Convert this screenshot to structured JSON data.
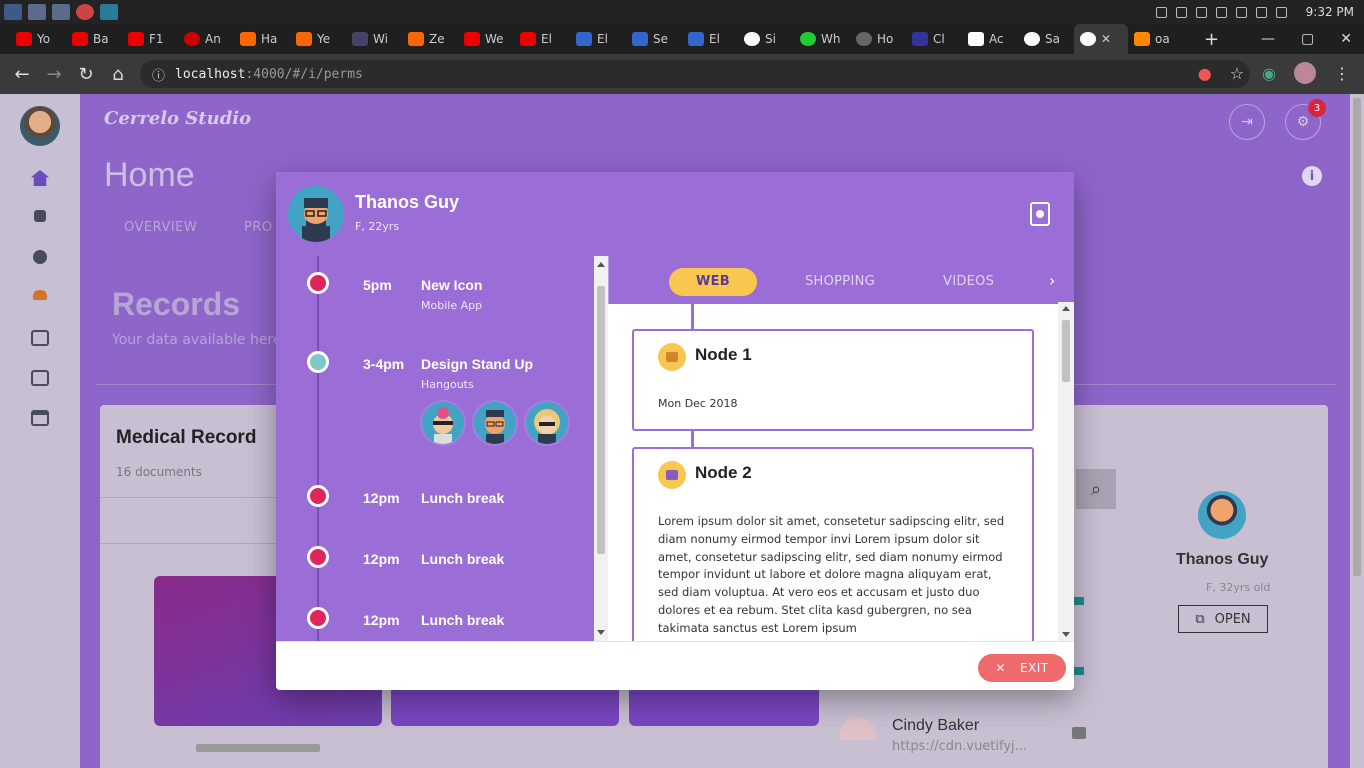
{
  "browser": {
    "tabs": [
      {
        "label": "Yo",
        "color": "#e00"
      },
      {
        "label": "Ba",
        "color": "#e00"
      },
      {
        "label": "F1",
        "color": "#e00"
      },
      {
        "label": "An",
        "color": "#c00"
      },
      {
        "label": "Ha",
        "color": "#f60"
      },
      {
        "label": "Ye",
        "color": "#f60"
      },
      {
        "label": "Wi",
        "color": "#446"
      },
      {
        "label": "Ze",
        "color": "#f60"
      },
      {
        "label": "We",
        "color": "#e00"
      },
      {
        "label": "El",
        "color": "#e00"
      },
      {
        "label": "El",
        "color": "#36c"
      },
      {
        "label": "Se",
        "color": "#36c"
      },
      {
        "label": "El",
        "color": "#36c"
      },
      {
        "label": "Si",
        "color": "#fff"
      },
      {
        "label": "Wh",
        "color": "#2c3"
      },
      {
        "label": "Ho",
        "color": "#666"
      },
      {
        "label": "Cl",
        "color": "#339"
      },
      {
        "label": "Ac",
        "color": "#fff"
      },
      {
        "label": "Sa",
        "color": "#fff"
      }
    ],
    "active_tab_close": "✕",
    "last_tab_label": "oa",
    "url_host": "localhost",
    "url_path": ":4000/#/i/perms",
    "clock": "9:32 PM"
  },
  "app": {
    "brand": "Cerrelo Studio",
    "settings_badge": "3",
    "page_title": "Home",
    "subtabs": [
      "OVERVIEW",
      "PRO"
    ],
    "records_title": "Records",
    "records_subtitle": "Your data available here",
    "card_title": "Medical Record",
    "card_subtitle": "16 documents",
    "side_name": "Thanos Guy",
    "side_sub": "F, 32yrs old",
    "open_label": "OPEN",
    "contact_name": "Cindy Baker",
    "contact_sub": "https://cdn.vuetifyj..."
  },
  "dialog": {
    "name": "Thanos Guy",
    "sub": "F, 22yrs",
    "timeline": [
      {
        "time": "5pm",
        "title": "New Icon",
        "sub": "Mobile App",
        "dot": "#e0245e"
      },
      {
        "time": "3-4pm",
        "title": "Design Stand Up",
        "sub": "Hangouts",
        "dot": "#7ec8c8"
      },
      {
        "time": "12pm",
        "title": "Lunch break",
        "sub": "",
        "dot": "#e0245e"
      },
      {
        "time": "12pm",
        "title": "Lunch break",
        "sub": "",
        "dot": "#e0245e"
      },
      {
        "time": "12pm",
        "title": "Lunch break",
        "sub": "",
        "dot": "#e0245e"
      }
    ],
    "tabs": [
      "WEB",
      "SHOPPING",
      "VIDEOS"
    ],
    "nodes": [
      {
        "title": "Node 1",
        "text": "Mon Dec 2018"
      },
      {
        "title": "Node 2",
        "text": "Lorem ipsum dolor sit amet, consetetur sadipscing elitr, sed diam nonumy eirmod tempor invi Lorem ipsum dolor sit amet, consetetur sadipscing elitr, sed diam nonumy eirmod tempor invidunt ut labore et dolore magna aliquyam erat, sed diam voluptua. At vero eos et accusam et justo duo dolores et ea rebum. Stet clita kasd gubergren, no sea takimata sanctus est Lorem ipsum"
      }
    ],
    "exit_label": "EXIT"
  },
  "colors": {
    "accent": "#9b6dd6",
    "tab_active": "#f9c74f",
    "exit": "#ef6b6b",
    "dot_red": "#e0245e"
  }
}
